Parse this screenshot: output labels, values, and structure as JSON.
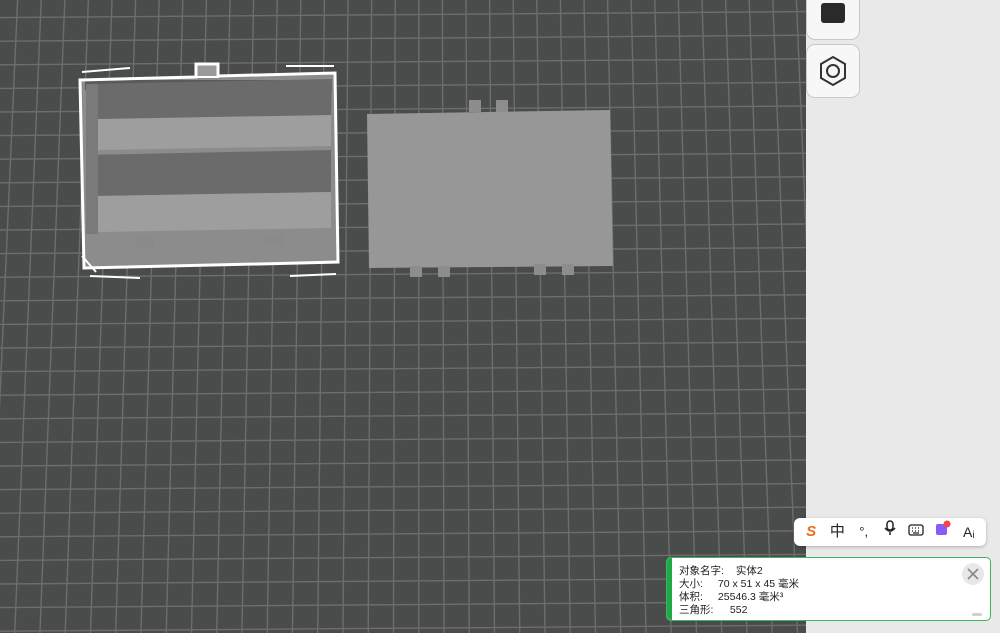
{
  "viewport": {
    "background": "#4a4b4b",
    "grid_color": "#6c6d6d",
    "objects": [
      {
        "name": "box-model-selected",
        "selected": true
      },
      {
        "name": "lid-model",
        "selected": false
      }
    ]
  },
  "toolbar": {
    "buttons": [
      {
        "name": "square-tool",
        "icon": "square-icon"
      },
      {
        "name": "hex-nut-tool",
        "icon": "hex-nut-icon"
      }
    ]
  },
  "ime": {
    "logo": "S",
    "mode": "中",
    "punct": "°,",
    "mic": "mic-icon",
    "keyboard": "keyboard-icon",
    "skin": "skin-icon",
    "ai": "Aᵢ"
  },
  "info": {
    "rows": [
      {
        "label": "对象名字:",
        "value": "实体2"
      },
      {
        "label": "大小:",
        "value": "70 x 51 x 45 毫米"
      },
      {
        "label": "体积:",
        "value": "25546.3 毫米³"
      },
      {
        "label": "三角形:",
        "value": "552"
      }
    ],
    "accent": "#1fa84a"
  }
}
